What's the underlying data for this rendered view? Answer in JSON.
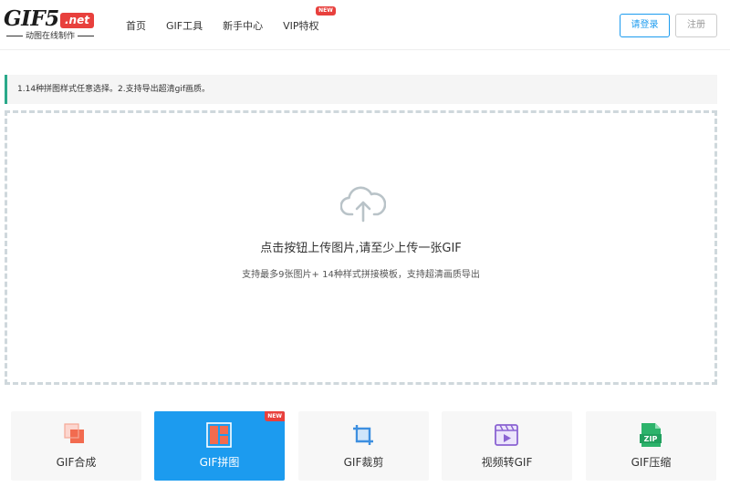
{
  "header": {
    "logo_main": "GIF5",
    "logo_badge": ".net",
    "logo_sub": "动图在线制作",
    "nav": [
      {
        "label": "首页"
      },
      {
        "label": "GIF工具"
      },
      {
        "label": "新手中心"
      },
      {
        "label": "VIP特权",
        "badge": "NEW"
      }
    ],
    "login_label": "请登录",
    "register_label": "注册"
  },
  "notice": {
    "text": "1.14种拼图样式任意选择。2.支持导出超清gif画质。",
    "accent_color": "#2aa98a"
  },
  "upload": {
    "icon": "cloud-upload-icon",
    "title": "点击按钮上传图片,请至少上传一张GIF",
    "subtitle": "支持最多9张图片+ 14种样式拼接模板，支持超清画质导出"
  },
  "tools": [
    {
      "label": "GIF合成",
      "icon": "gif-compose-icon",
      "active": false
    },
    {
      "label": "GIF拼图",
      "icon": "gif-collage-icon",
      "active": true,
      "badge": "NEW"
    },
    {
      "label": "GIF裁剪",
      "icon": "crop-icon",
      "active": false
    },
    {
      "label": "视频转GIF",
      "icon": "video-to-gif-icon",
      "active": false
    },
    {
      "label": "GIF压缩",
      "icon": "zip-compress-icon",
      "active": false
    }
  ],
  "colors": {
    "brand_blue": "#1c9bef",
    "badge_red": "#e8403d"
  }
}
